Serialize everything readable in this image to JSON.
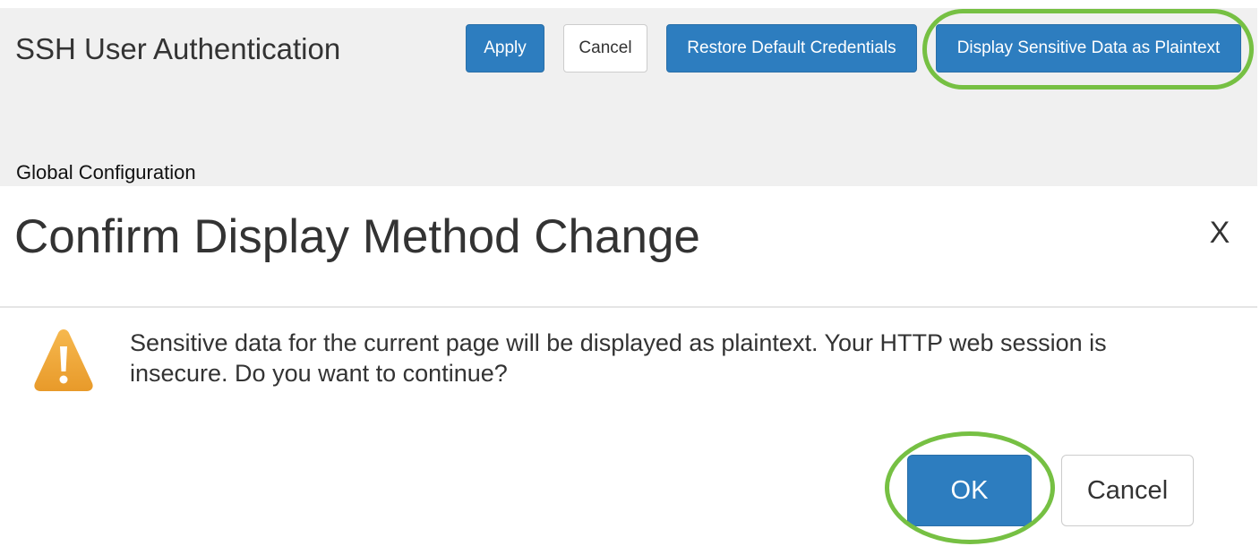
{
  "header": {
    "title": "SSH User Authentication",
    "buttons": {
      "apply": "Apply",
      "cancel": "Cancel",
      "restore": "Restore Default Credentials",
      "display_plaintext": "Display Sensitive Data as Plaintext"
    }
  },
  "section": {
    "label": "Global Configuration"
  },
  "dialog": {
    "title": "Confirm Display Method Change",
    "close": "X",
    "message": "Sensitive data for the current page will be displayed as plaintext. Your HTTP web session is insecure. Do you want to continue?",
    "icon": "warning-icon",
    "buttons": {
      "ok": "OK",
      "cancel": "Cancel"
    }
  },
  "colors": {
    "primary": "#2d7dbf",
    "highlight": "#76c043",
    "warning": "#f0a030",
    "band": "#f0f0f0"
  }
}
